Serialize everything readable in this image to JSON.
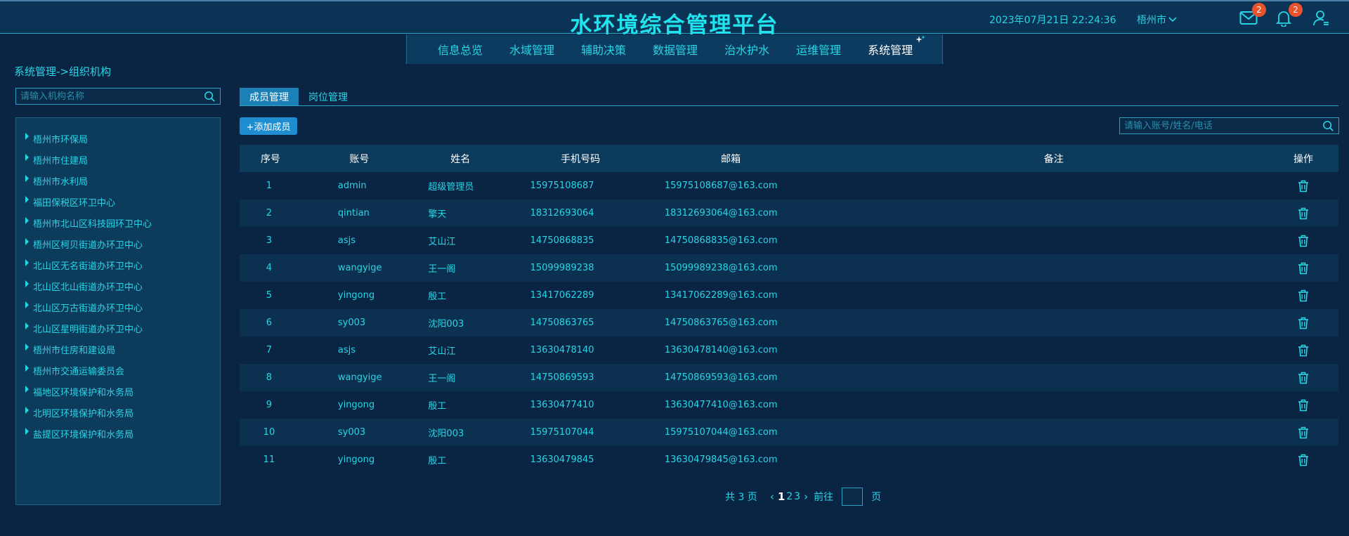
{
  "header": {
    "title": "水环境综合管理平台",
    "datetime": "2023年07月21日 22:24:36",
    "city": "梧州市",
    "mail_badge": "2",
    "bell_badge": "2"
  },
  "nav": {
    "items": [
      {
        "label": "信息总览"
      },
      {
        "label": "水域管理"
      },
      {
        "label": "辅助决策"
      },
      {
        "label": "数据管理"
      },
      {
        "label": "治水护水"
      },
      {
        "label": "运维管理"
      },
      {
        "label": "系统管理"
      }
    ],
    "active": "系统管理"
  },
  "breadcrumb": "系统管理->组织机构",
  "left_search": {
    "placeholder": "请输入机构名称"
  },
  "tree": {
    "items": [
      {
        "label": "梧州市环保局"
      },
      {
        "label": "梧州市住建局"
      },
      {
        "label": "梧州市水利局"
      },
      {
        "label": "福田保税区环卫中心"
      },
      {
        "label": "梧州市北山区科技园环卫中心"
      },
      {
        "label": "梧州区柯贝街道办环卫中心"
      },
      {
        "label": "北山区无名街道办环卫中心"
      },
      {
        "label": "北山区北山街道办环卫中心"
      },
      {
        "label": "北山区万古街道办环卫中心"
      },
      {
        "label": "北山区星明街道办环卫中心"
      },
      {
        "label": "梧州市住房和建设局"
      },
      {
        "label": "梧州市交通运输委员会"
      },
      {
        "label": "福地区环境保护和水务局"
      },
      {
        "label": "北明区环境保护和水务局"
      },
      {
        "label": "盐提区环境保护和水务局"
      }
    ]
  },
  "tabs": [
    {
      "label": "成员管理",
      "active": true
    },
    {
      "label": "岗位管理",
      "active": false
    }
  ],
  "add_button": "+添加成员",
  "right_search": {
    "placeholder": "请输入账号/姓名/电话"
  },
  "table": {
    "headers": {
      "no": "序号",
      "account": "账号",
      "name": "姓名",
      "phone": "手机号码",
      "email": "邮箱",
      "note": "备注",
      "op": "操作"
    },
    "rows": [
      {
        "no": "1",
        "account": "admin",
        "name": "超级管理员",
        "phone": "15975108687",
        "email": "15975108687@163.com",
        "note": ""
      },
      {
        "no": "2",
        "account": "qintian",
        "name": "擎天",
        "phone": "18312693064",
        "email": "18312693064@163.com",
        "note": ""
      },
      {
        "no": "3",
        "account": "asjs",
        "name": "艾山江",
        "phone": "14750868835",
        "email": "14750868835@163.com",
        "note": ""
      },
      {
        "no": "4",
        "account": "wangyige",
        "name": "王一阁",
        "phone": "15099989238",
        "email": "15099989238@163.com",
        "note": ""
      },
      {
        "no": "5",
        "account": "yingong",
        "name": "殷工",
        "phone": "13417062289",
        "email": "13417062289@163.com",
        "note": ""
      },
      {
        "no": "6",
        "account": "sy003",
        "name": "沈阳003",
        "phone": "14750863765",
        "email": "14750863765@163.com",
        "note": ""
      },
      {
        "no": "7",
        "account": "asjs",
        "name": "艾山江",
        "phone": "13630478140",
        "email": "13630478140@163.com",
        "note": ""
      },
      {
        "no": "8",
        "account": "wangyige",
        "name": "王一阁",
        "phone": "14750869593",
        "email": "14750869593@163.com",
        "note": ""
      },
      {
        "no": "9",
        "account": "yingong",
        "name": "殷工",
        "phone": "13630477410",
        "email": "13630477410@163.com",
        "note": ""
      },
      {
        "no": "10",
        "account": "sy003",
        "name": "沈阳003",
        "phone": "15975107044",
        "email": "15975107044@163.com",
        "note": ""
      },
      {
        "no": "11",
        "account": "yingong",
        "name": "殷工",
        "phone": "13630479845",
        "email": "13630479845@163.com",
        "note": ""
      }
    ]
  },
  "pager": {
    "total_text": "共 3 页",
    "pages": [
      "1",
      "2",
      "3"
    ],
    "current": "1",
    "goto_label": "前往",
    "page_suffix": "页"
  },
  "colors": {
    "background": "#0a2444",
    "accent": "#27d6e6",
    "active_tab": "#1c80b6",
    "badge": "#e8522c"
  }
}
